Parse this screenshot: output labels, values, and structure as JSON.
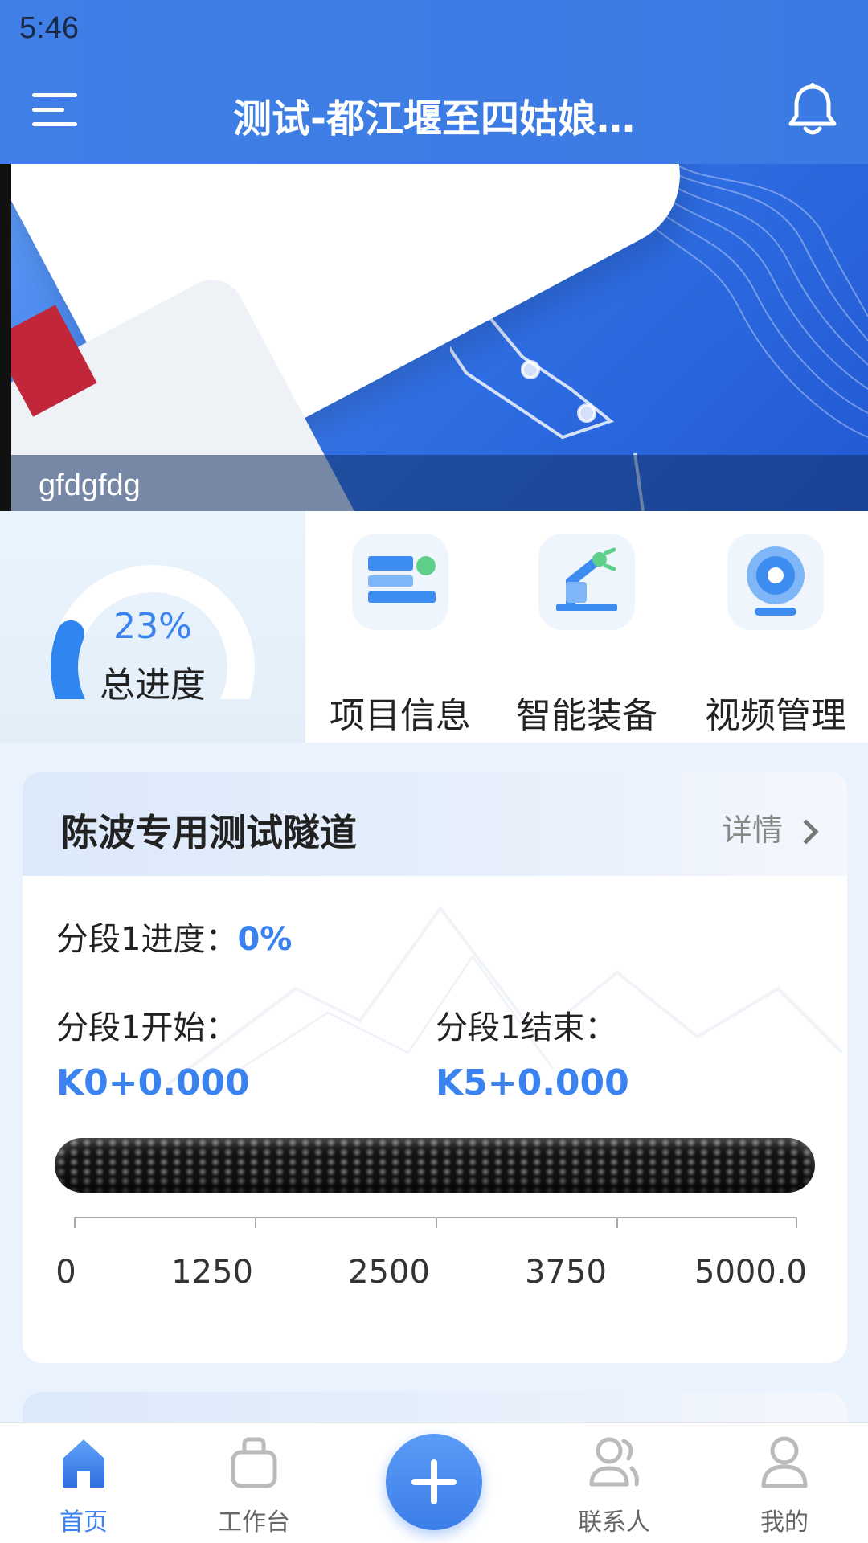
{
  "status_bar": {
    "time": "5:46"
  },
  "header": {
    "title": "测试-都江堰至四姑娘…"
  },
  "banner": {
    "caption": "gfdgfdg"
  },
  "progress": {
    "value_text": "23%",
    "fraction": 0.23,
    "label": "总进度"
  },
  "quick_actions": [
    {
      "label": "项目信息",
      "icon": "project-info-icon"
    },
    {
      "label": "智能装备",
      "icon": "robot-arm-icon"
    },
    {
      "label": "视频管理",
      "icon": "camera-icon"
    }
  ],
  "tunnel_card": {
    "title": "陈波专用测试隧道",
    "detail_label": "详情",
    "segment_progress_label": "分段1进度：",
    "segment_progress_value": "0%",
    "segment_start_label": "分段1开始：",
    "segment_start_value": "K0+0.000",
    "segment_end_label": "分段1结束：",
    "segment_end_value": "K5+0.000",
    "scale_labels": [
      "0",
      "1250",
      "2500",
      "3750",
      "5000.0"
    ]
  },
  "bottom_nav": [
    {
      "label": "首页",
      "icon": "home-icon",
      "active": true
    },
    {
      "label": "工作台",
      "icon": "briefcase-icon",
      "active": false
    },
    {
      "label": "",
      "icon": "plus-icon",
      "active": false
    },
    {
      "label": "联系人",
      "icon": "contacts-icon",
      "active": false
    },
    {
      "label": "我的",
      "icon": "user-icon",
      "active": false
    }
  ],
  "colors": {
    "primary": "#3a82ef",
    "header_bg": "#3f7fe6",
    "page_bg": "#eaf2fd"
  }
}
